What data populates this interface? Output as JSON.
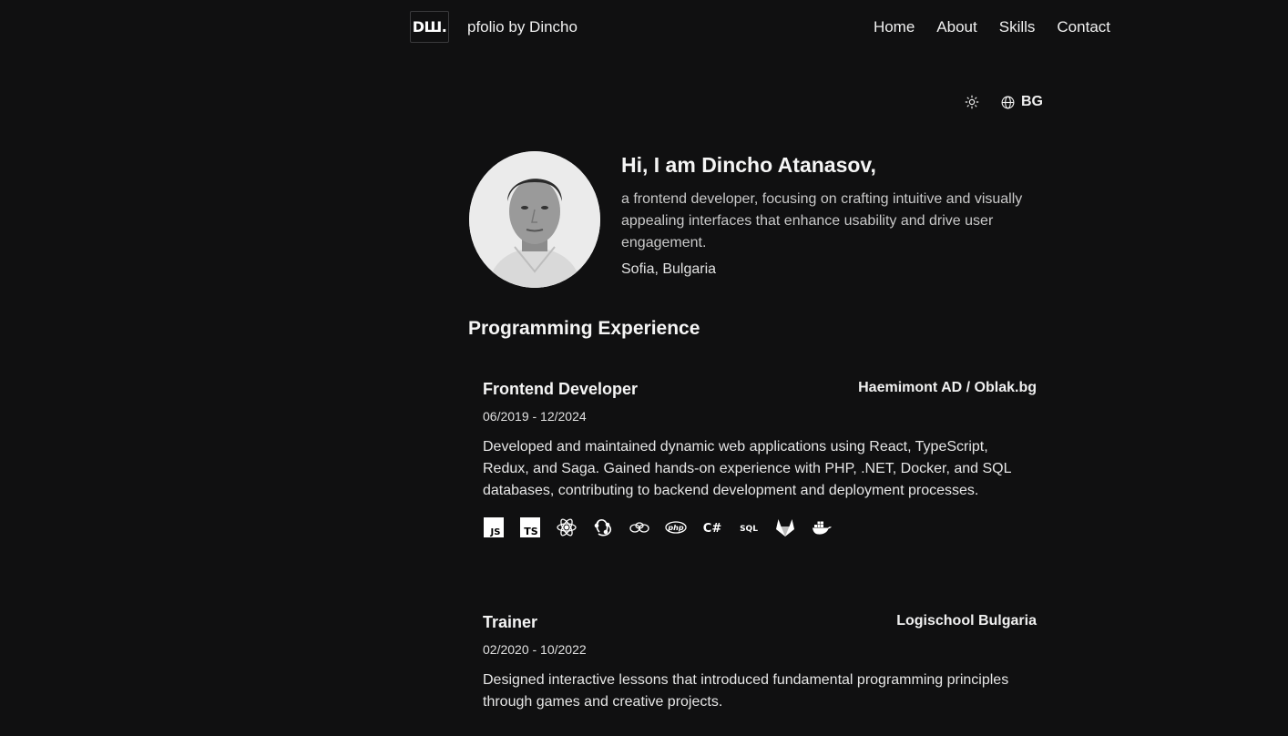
{
  "nav": {
    "logo": "DШ.",
    "brand": "pfolio by Dincho",
    "links": [
      "Home",
      "About",
      "Skills",
      "Contact"
    ]
  },
  "controls": {
    "theme_icon": "sun-icon",
    "language_icon": "globe-icon",
    "language_label": "BG"
  },
  "hero": {
    "greeting": "Hi, I am Dincho Atanasov,",
    "description": "a frontend developer, focusing on crafting intuitive and visually appealing interfaces that enhance usability and drive user engagement.",
    "location": "Sofia, Bulgaria"
  },
  "experience": {
    "section_title": "Programming Experience",
    "jobs": [
      {
        "title": "Frontend Developer",
        "company": "Haemimont AD / Oblak.bg",
        "dates": "06/2019 - 12/2024",
        "description": "Developed and maintained dynamic web applications using React, TypeScript, Redux, and Saga. Gained hands-on experience with PHP, .NET, Docker, and SQL databases, contributing to backend development and deployment processes.",
        "techs": [
          {
            "icon": "javascript-icon",
            "text": "JS"
          },
          {
            "icon": "typescript-icon",
            "text": "TS"
          },
          {
            "icon": "react-icon"
          },
          {
            "icon": "redux-icon"
          },
          {
            "icon": "redux-saga-icon"
          },
          {
            "icon": "php-icon",
            "text": "php"
          },
          {
            "icon": "csharp-icon",
            "text": "C#"
          },
          {
            "icon": "sql-icon",
            "text": "SQL"
          },
          {
            "icon": "gitlab-icon"
          },
          {
            "icon": "docker-icon"
          }
        ]
      },
      {
        "title": "Trainer",
        "company": "Logischool Bulgaria",
        "dates": "02/2020 - 10/2022",
        "description": "Designed interactive lessons that introduced fundamental programming principles through games and creative projects."
      }
    ]
  }
}
